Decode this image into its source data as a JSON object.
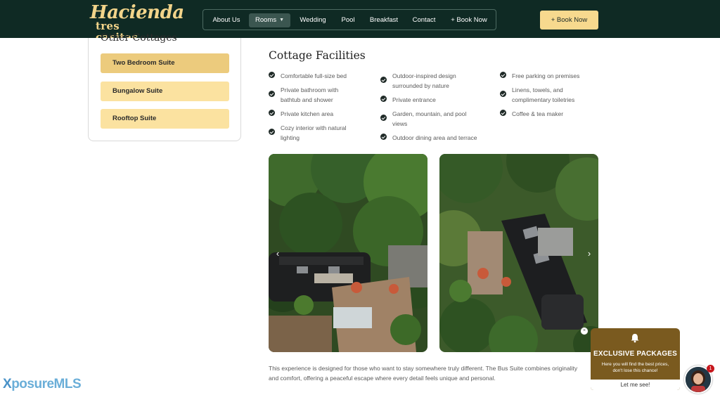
{
  "header": {
    "logo_line1": "Hacienda",
    "logo_line2": "tres casitas",
    "nav": [
      {
        "label": "About Us"
      },
      {
        "label": "Rooms"
      },
      {
        "label": "Wedding"
      },
      {
        "label": "Pool"
      },
      {
        "label": "Breakfast"
      },
      {
        "label": "Contact"
      },
      {
        "label": "+ Book Now"
      }
    ],
    "book_button": "+ Book Now"
  },
  "sidebar": {
    "title": "Other Cottages",
    "items": [
      {
        "label": "Two Bedroom Suite"
      },
      {
        "label": "Bungalow Suite"
      },
      {
        "label": "Rooftop Suite"
      }
    ]
  },
  "facilities": {
    "title": "Cottage Facilities",
    "col1": [
      {
        "l1": "Comfortable full-size bed",
        "l2": ""
      },
      {
        "l1": "Private bathroom with",
        "l2": "bathtub and shower"
      },
      {
        "l1": "Private kitchen area",
        "l2": ""
      },
      {
        "l1": "Cozy interior with natural",
        "l2": "lighting"
      }
    ],
    "col2": [
      {
        "l1": "Outdoor-inspired design",
        "l2": "surrounded by nature"
      },
      {
        "l1": "Private entrance",
        "l2": ""
      },
      {
        "l1": "Garden, mountain, and pool",
        "l2": "views"
      },
      {
        "l1": "Outdoor dining area and terrace",
        "l2": ""
      }
    ],
    "col3": [
      {
        "l1": "Free parking on premises",
        "l2": ""
      },
      {
        "l1": "Linens, towels, and",
        "l2": "complimentary toiletries"
      },
      {
        "l1": "Coffee & tea maker",
        "l2": ""
      }
    ]
  },
  "description_line1": "This experience is designed for those who want to stay somewhere truly different. The Bus Suite combines originality",
  "description_line2": "and comfort, offering a peaceful escape where every detail feels unique and personal.",
  "watermark": {
    "x": "X",
    "rest": "posureMLS"
  },
  "popup": {
    "title": "EXCLUSIVE PACKAGES",
    "text": "Here you will find the best prices, don't lose this chance!",
    "button": "Let me see!",
    "close": "×",
    "badge": "1"
  }
}
